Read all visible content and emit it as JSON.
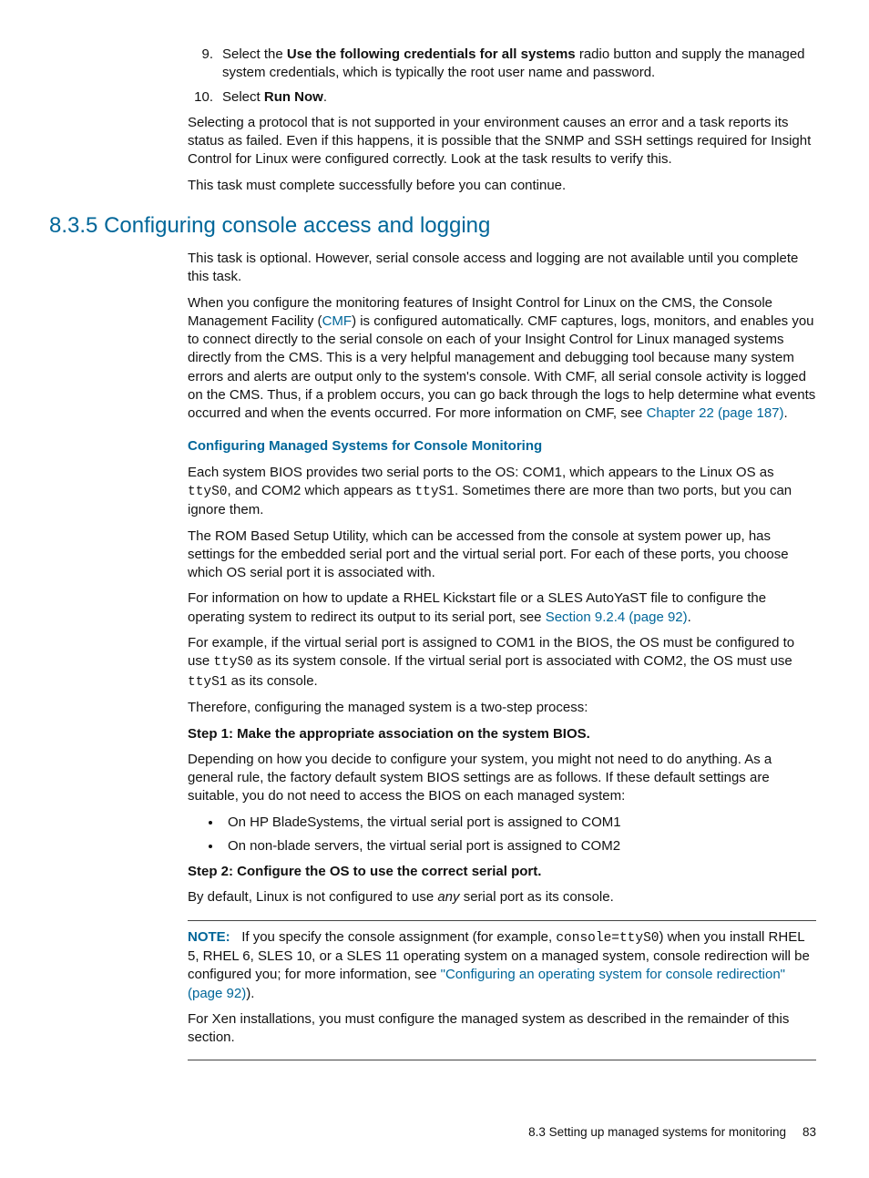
{
  "list": {
    "item9": {
      "num": "9.",
      "pre": "Select the ",
      "bold": "Use the following credentials for all systems",
      "post": " radio button and supply the managed system credentials, which is typically the root user name and password."
    },
    "item10": {
      "num": "10.",
      "pre": "Select ",
      "bold": "Run Now",
      "post": "."
    }
  },
  "para1": "Selecting a protocol that is not supported in your environment causes an error and a task reports its status as failed. Even if this happens, it is possible that the SNMP and SSH settings required for Insight Control for Linux were configured correctly. Look at the task results to verify this.",
  "para2": "This task must complete successfully before you can continue.",
  "section": {
    "num": "8.3.5",
    "title": "Configuring console access and logging"
  },
  "s1p1": "This task is optional. However, serial console access and logging are not available until you complete this task.",
  "s1p2a": "When you configure the monitoring features of Insight Control for Linux on the CMS, the Console Management Facility (",
  "s1p2link": "CMF",
  "s1p2b": ") is configured automatically. CMF captures, logs, monitors, and enables you to connect directly to the serial console on each of your Insight Control for Linux managed systems directly from the CMS. This is a very helpful management and debugging tool because many system errors and alerts are output only to the system's console. With CMF, all serial console activity is logged on the CMS. Thus, if a problem occurs, you can go back through the logs to help determine what events occurred and when the events occurred. For more information on CMF, see ",
  "s1p2link2": "Chapter 22 (page 187)",
  "s1p2c": ".",
  "sub1": "Configuring Managed Systems for Console Monitoring",
  "s2p1a": "Each system BIOS provides two serial ports to the OS: COM1, which appears to the Linux OS as ",
  "s2p1code1": "ttyS0",
  "s2p1b": ", and COM2 which appears as ",
  "s2p1code2": "ttyS1",
  "s2p1c": ". Sometimes there are more than two ports, but you can ignore them.",
  "s2p2": "The ROM Based Setup Utility, which can be accessed from the console at system power up, has settings for the embedded serial port and the virtual serial port. For each of these ports, you choose which OS serial port it is associated with.",
  "s2p3a": "For information on how to update a RHEL Kickstart file or a SLES AutoYaST file to configure the operating system to redirect its output to its serial port, see ",
  "s2p3link": "Section 9.2.4 (page 92)",
  "s2p3b": ".",
  "s2p4a": "For example, if the virtual serial port is assigned to COM1 in the BIOS, the OS must be configured to use ",
  "s2p4code1": "ttyS0",
  "s2p4b": " as its system console. If the virtual serial port is associated with COM2, the OS must use ",
  "s2p4code2": "ttyS1",
  "s2p4c": " as its console.",
  "s2p5": "Therefore, configuring the managed system is a two-step process:",
  "step1": "Step 1: Make the appropriate association on the system BIOS.",
  "s3p1": "Depending on how you decide to configure your system, you might not need to do anything. As a general rule, the factory default system BIOS settings are as follows. If these default settings are suitable, you do not need to access the BIOS on each managed system:",
  "bullet1": "On HP BladeSystems, the virtual serial port is assigned to COM1",
  "bullet2": "On non-blade servers, the virtual serial port is assigned to COM2",
  "step2": "Step 2: Configure the OS to use the correct serial port.",
  "s4p1a": "By default, Linux is not configured to use ",
  "s4p1em": "any",
  "s4p1b": " serial port as its console.",
  "note": {
    "label": "NOTE:",
    "p1a": "If you specify the console assignment (for example, ",
    "p1code": "console=ttyS0",
    "p1b": ") when you install RHEL 5, RHEL 6, SLES 10, or a SLES 11 operating system on a managed system, console redirection will be configured you; for more information, see ",
    "p1link": "\"Configuring an operating system for console redirection\" (page 92)",
    "p1c": ").",
    "p2": "For Xen installations, you must configure the managed system as described in the remainder of this section."
  },
  "footer": {
    "text": "8.3 Setting up managed systems for monitoring",
    "page": "83"
  }
}
